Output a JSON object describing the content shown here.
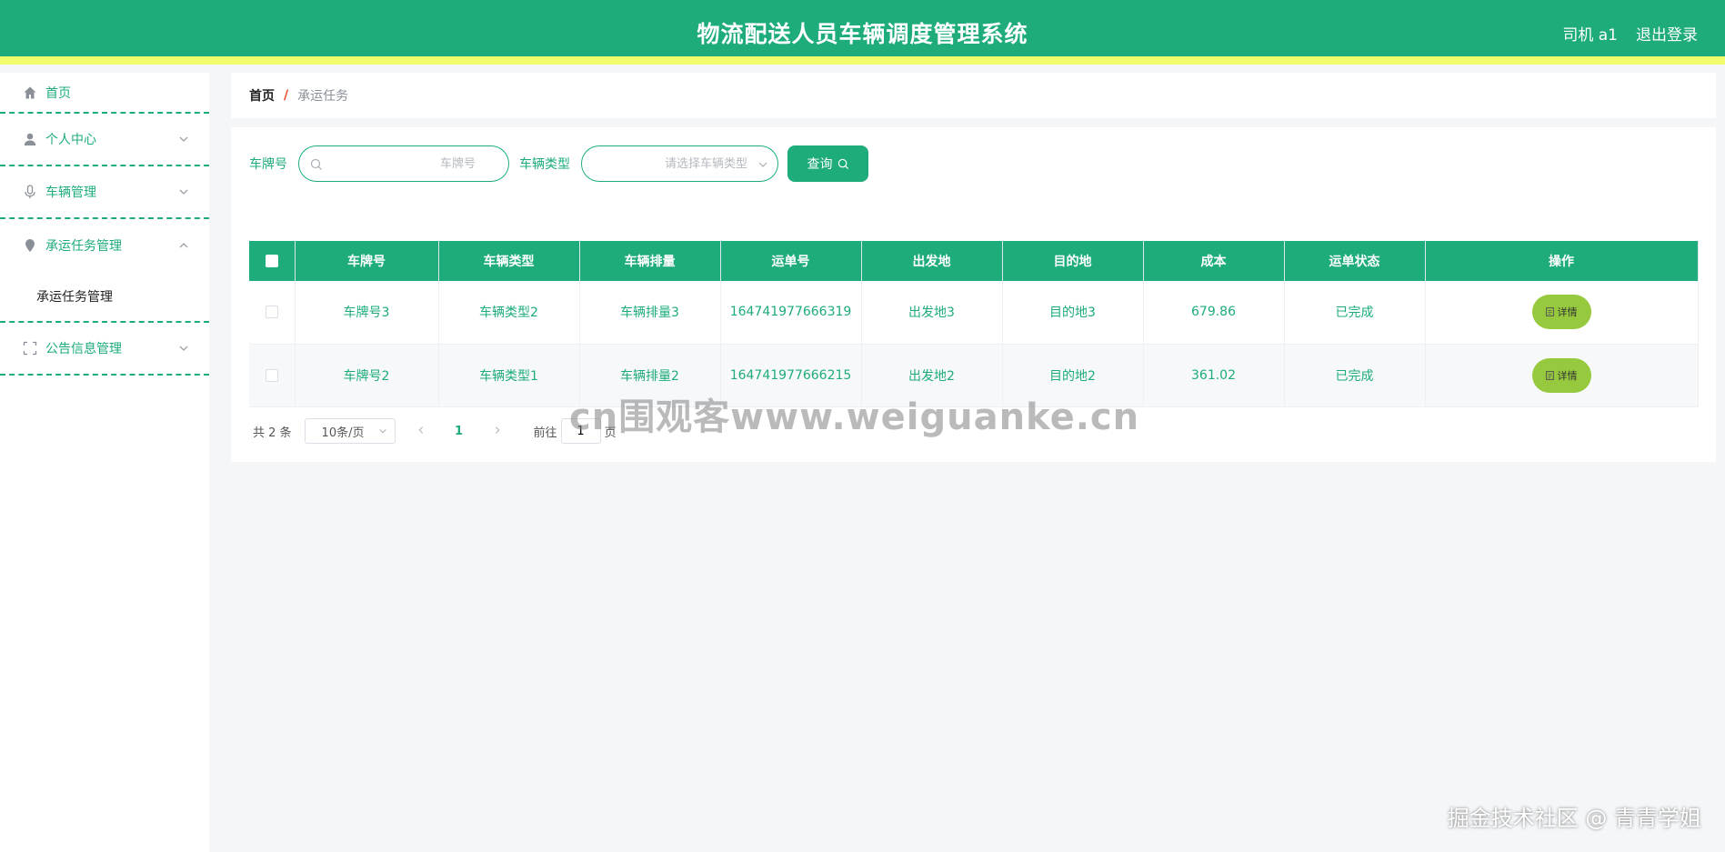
{
  "header": {
    "title": "物流配送人员车辆调度管理系统",
    "user": "司机 a1",
    "logout": "退出登录"
  },
  "sidebar": {
    "items": [
      {
        "label": "首页",
        "icon": "home-icon"
      },
      {
        "label": "个人中心",
        "icon": "user-icon"
      },
      {
        "label": "车辆管理",
        "icon": "microphone-icon"
      },
      {
        "label": "承运任务管理",
        "icon": "map-pin-icon",
        "sub": "承运任务管理"
      },
      {
        "label": "公告信息管理",
        "icon": "scan-icon"
      }
    ]
  },
  "breadcrumb": {
    "home": "首页",
    "sep": "/",
    "current": "承运任务"
  },
  "search": {
    "plate_label": "车牌号",
    "plate_placeholder": "车牌号",
    "type_label": "车辆类型",
    "type_placeholder": "请选择车辆类型",
    "query_label": "查询"
  },
  "table": {
    "headers": [
      "车牌号",
      "车辆类型",
      "车辆排量",
      "运单号",
      "出发地",
      "目的地",
      "成本",
      "运单状态",
      "操作"
    ],
    "rows": [
      {
        "plate": "车牌号3",
        "type": "车辆类型2",
        "displacement": "车辆排量3",
        "waybill": "164741977666319",
        "origin": "出发地3",
        "destination": "目的地3",
        "cost": "679.86",
        "status": "已完成"
      },
      {
        "plate": "车牌号2",
        "type": "车辆类型1",
        "displacement": "车辆排量2",
        "waybill": "164741977666215",
        "origin": "出发地2",
        "destination": "目的地2",
        "cost": "361.02",
        "status": "已完成"
      }
    ],
    "detail_label": "详情"
  },
  "pagination": {
    "total": "共 2 条",
    "page_size": "10条/页",
    "current_page": "1",
    "goto_prefix": "前往",
    "goto_value": "1",
    "goto_suffix": "页"
  },
  "watermarks": {
    "center": "cn围观客www.weiguanke.cn",
    "corner": "掘金技术社区 @ 青青学姐"
  },
  "colors": {
    "primary": "#1dac7a",
    "accent_bar": "#f2fb6a",
    "detail_button": "#96c93d"
  }
}
